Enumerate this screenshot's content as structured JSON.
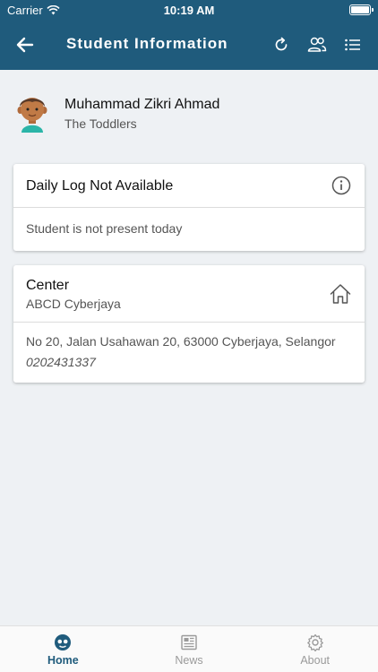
{
  "status_bar": {
    "carrier": "Carrier",
    "time": "10:19 AM"
  },
  "nav": {
    "title": "Student Information"
  },
  "student": {
    "name": "Muhammad Zikri Ahmad",
    "class": "The Toddlers"
  },
  "daily_log": {
    "title": "Daily Log Not Available",
    "message": "Student is not present today"
  },
  "center": {
    "label": "Center",
    "name": "ABCD Cyberjaya",
    "address": "No 20, Jalan Usahawan 20, 63000 Cyberjaya, Selangor",
    "phone": "0202431337"
  },
  "tabs": [
    {
      "label": "Home",
      "icon": "home-face-icon",
      "active": true
    },
    {
      "label": "News",
      "icon": "newspaper-icon",
      "active": false
    },
    {
      "label": "About",
      "icon": "gear-icon",
      "active": false
    }
  ],
  "colors": {
    "primary": "#1f5b7c",
    "background": "#eef1f4",
    "inactive": "#9a9a9a"
  }
}
